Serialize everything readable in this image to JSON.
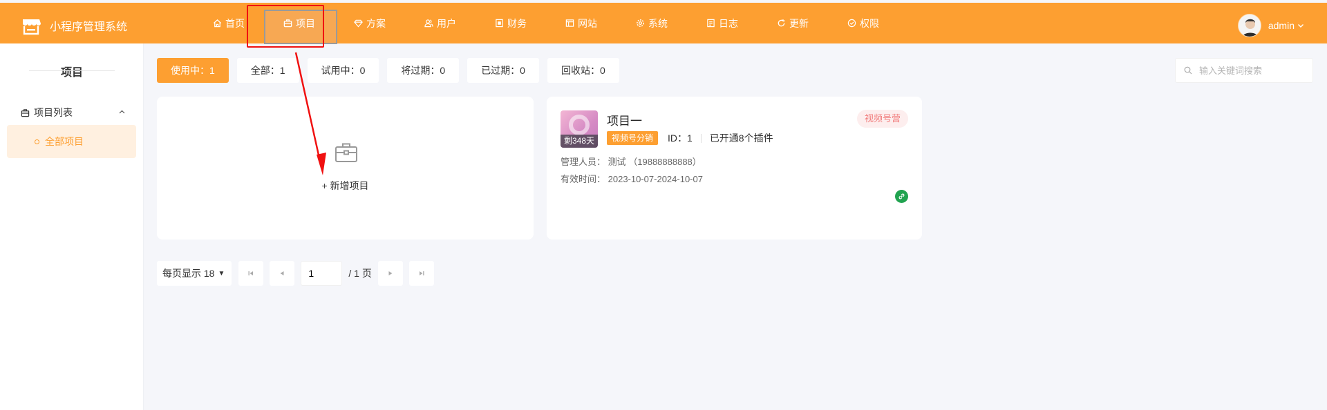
{
  "app": {
    "title": "小程序管理系统"
  },
  "nav": [
    {
      "label": "首页",
      "icon": "home-icon"
    },
    {
      "label": "项目",
      "icon": "briefcase-icon",
      "active": true
    },
    {
      "label": "方案",
      "icon": "diamond-icon"
    },
    {
      "label": "用户",
      "icon": "users-icon"
    },
    {
      "label": "财务",
      "icon": "finance-icon"
    },
    {
      "label": "网站",
      "icon": "website-icon"
    },
    {
      "label": "系统",
      "icon": "gear-icon"
    },
    {
      "label": "日志",
      "icon": "log-icon"
    },
    {
      "label": "更新",
      "icon": "refresh-icon"
    },
    {
      "label": "权限",
      "icon": "shield-check-icon"
    }
  ],
  "user": {
    "name": "admin"
  },
  "sidebar": {
    "title": "项目",
    "group": "项目列表",
    "sub_item": "全部项目"
  },
  "filter_tabs": [
    {
      "label": "使用中：1",
      "active": true
    },
    {
      "label": "全部：1"
    },
    {
      "label": "试用中：0"
    },
    {
      "label": "将过期：0"
    },
    {
      "label": "已过期：0"
    },
    {
      "label": "回收站：0"
    }
  ],
  "search": {
    "placeholder": "输入关键词搜索"
  },
  "add_card": {
    "label": "+ 新增项目"
  },
  "project": {
    "name": "项目一",
    "days_left": "剩348天",
    "type_badge": "视频号分销",
    "id_text": "ID：1",
    "plugins": "已开通8个插件",
    "tag": "视频号营",
    "manager_label": "管理人员：",
    "manager_value": "测试 （19888888888）",
    "valid_label": "有效时间：",
    "valid_value": "2023-10-07-2024-10-07"
  },
  "pager": {
    "per_page": "每页显示 18",
    "current": "1",
    "total": "/ 1 页"
  },
  "colors": {
    "accent": "#fd9f31",
    "highlight": "#f01010",
    "link_green": "#21a350"
  }
}
